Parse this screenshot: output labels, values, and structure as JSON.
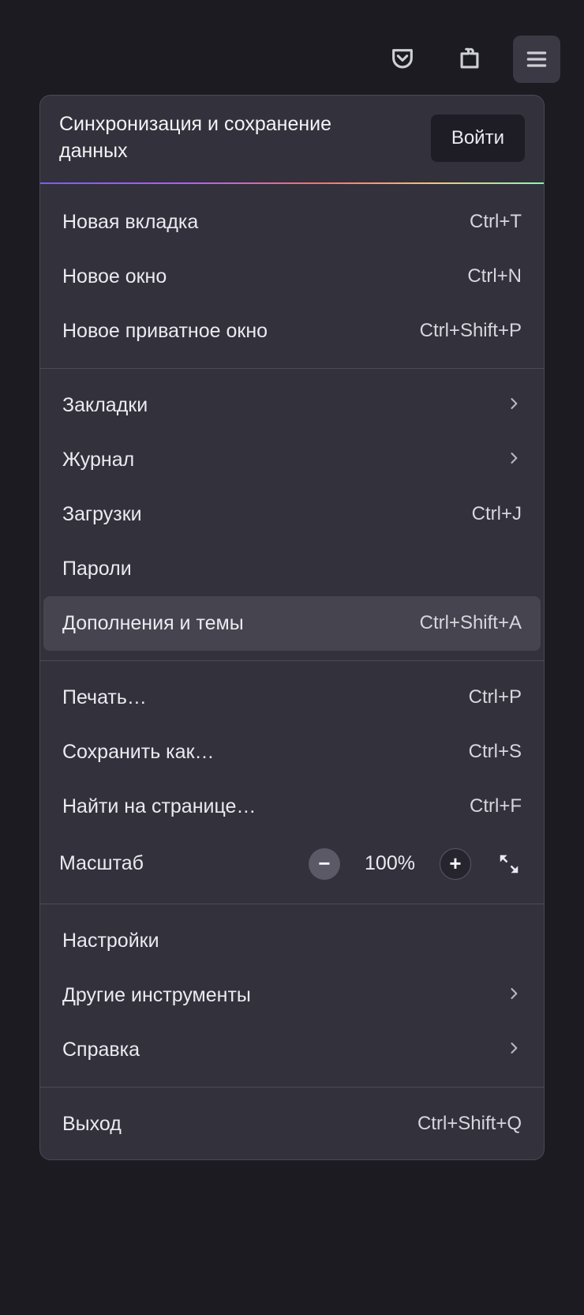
{
  "sync": {
    "title": "Синхронизация и сохранение данных",
    "login": "Войти"
  },
  "zoom": {
    "label": "Масштаб",
    "value": "100%"
  },
  "items": {
    "new_tab": {
      "label": "Новая вкладка",
      "shortcut": "Ctrl+T"
    },
    "new_window": {
      "label": "Новое окно",
      "shortcut": "Ctrl+N"
    },
    "new_private": {
      "label": "Новое приватное окно",
      "shortcut": "Ctrl+Shift+P"
    },
    "bookmarks": {
      "label": "Закладки"
    },
    "history": {
      "label": "Журнал"
    },
    "downloads": {
      "label": "Загрузки",
      "shortcut": "Ctrl+J"
    },
    "passwords": {
      "label": "Пароли"
    },
    "addons": {
      "label": "Дополнения и темы",
      "shortcut": "Ctrl+Shift+A"
    },
    "print": {
      "label": "Печать…",
      "shortcut": "Ctrl+P"
    },
    "save_as": {
      "label": "Сохранить как…",
      "shortcut": "Ctrl+S"
    },
    "find": {
      "label": "Найти на странице…",
      "shortcut": "Ctrl+F"
    },
    "settings": {
      "label": "Настройки"
    },
    "more_tools": {
      "label": "Другие инструменты"
    },
    "help": {
      "label": "Справка"
    },
    "exit": {
      "label": "Выход",
      "shortcut": "Ctrl+Shift+Q"
    }
  }
}
